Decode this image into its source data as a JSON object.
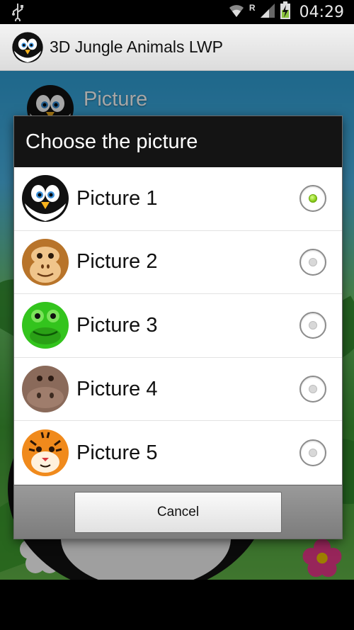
{
  "status_bar": {
    "time": "04:29",
    "icons": [
      "usb-icon",
      "wifi-icon",
      "roaming-icon",
      "signal-icon",
      "battery-charging-icon"
    ],
    "roaming_letter": "R"
  },
  "app_bar": {
    "title": "3D Jungle Animals LWP",
    "icon": "penguin-app-icon"
  },
  "background_preference": {
    "title": "Picture"
  },
  "dialog": {
    "title": "Choose the picture",
    "options": [
      {
        "label": "Picture 1",
        "icon": "penguin-icon",
        "checked": true
      },
      {
        "label": "Picture 2",
        "icon": "monkey-icon",
        "checked": false
      },
      {
        "label": "Picture 3",
        "icon": "frog-icon",
        "checked": false
      },
      {
        "label": "Picture 4",
        "icon": "hippo-icon",
        "checked": false
      },
      {
        "label": "Picture 5",
        "icon": "tiger-icon",
        "checked": false
      }
    ],
    "cancel_label": "Cancel"
  },
  "colors": {
    "dialog_header": "#141414",
    "radio_checked": "#8ccf1b",
    "app_bar": "#e6e6e6"
  }
}
